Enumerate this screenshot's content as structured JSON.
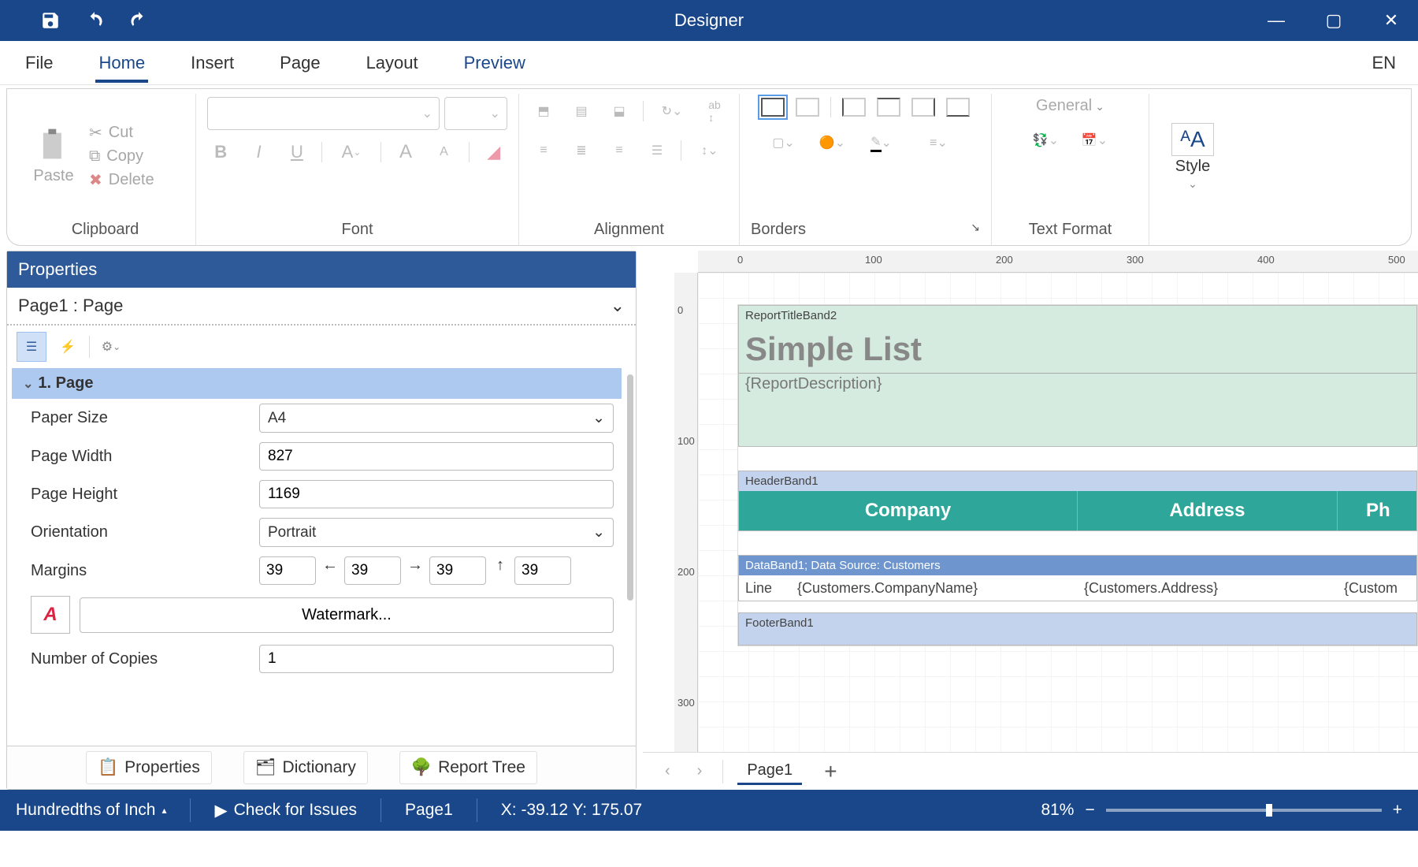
{
  "app": {
    "title": "Designer",
    "language": "EN"
  },
  "tabs": {
    "file": "File",
    "home": "Home",
    "insert": "Insert",
    "page": "Page",
    "layout": "Layout",
    "preview": "Preview"
  },
  "ribbon": {
    "clipboard": {
      "label": "Clipboard",
      "paste": "Paste",
      "cut": "Cut",
      "copy": "Copy",
      "delete": "Delete"
    },
    "font": {
      "label": "Font"
    },
    "alignment": {
      "label": "Alignment"
    },
    "borders": {
      "label": "Borders"
    },
    "textformat": {
      "label": "Text Format",
      "general": "General"
    },
    "style": {
      "label": "Style"
    }
  },
  "properties": {
    "panel_title": "Properties",
    "selection": "Page1 : Page",
    "category": "1. Page",
    "paper_size_label": "Paper Size",
    "paper_size": "A4",
    "page_width_label": "Page Width",
    "page_width": "827",
    "page_height_label": "Page Height",
    "page_height": "1169",
    "orientation_label": "Orientation",
    "orientation": "Portrait",
    "margins_label": "Margins",
    "margin_left": "39",
    "margin_right": "39",
    "margin_top": "39",
    "margin_bottom": "39",
    "watermark_button": "Watermark...",
    "copies_label": "Number of Copies",
    "copies": "1",
    "tab_properties": "Properties",
    "tab_dictionary": "Dictionary",
    "tab_tree": "Report Tree"
  },
  "ruler": {
    "h": [
      "0",
      "100",
      "200",
      "300",
      "400",
      "500"
    ],
    "v": [
      "0",
      "100",
      "200",
      "300"
    ]
  },
  "report": {
    "title_band": "ReportTitleBand2",
    "title": "Simple List",
    "description": "{ReportDescription}",
    "header_band": "HeaderBand1",
    "columns": [
      "Company",
      "Address",
      "Ph"
    ],
    "data_band": "DataBand1; Data Source: Customers",
    "data_cells": [
      "Line",
      "{Customers.CompanyName}",
      "{Customers.Address}",
      "{Custom"
    ],
    "footer_band": "FooterBand1"
  },
  "page_tabs": {
    "page1": "Page1"
  },
  "status": {
    "units": "Hundredths of Inch",
    "check": "Check for Issues",
    "page": "Page1",
    "coords": "X: -39.12 Y: 175.07",
    "zoom": "81%"
  }
}
